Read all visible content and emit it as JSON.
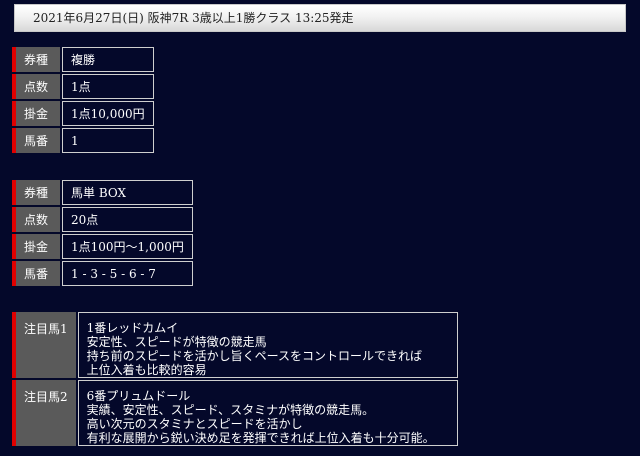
{
  "header": {
    "title": "2021年6月27日(日) 阪神7R 3歳以上1勝クラス 13:25発走"
  },
  "bet1": {
    "rows": [
      {
        "label": "券種",
        "value": "複勝"
      },
      {
        "label": "点数",
        "value": "1点"
      },
      {
        "label": "掛金",
        "value": "1点10,000円"
      },
      {
        "label": "馬番",
        "value": "1"
      }
    ]
  },
  "bet2": {
    "rows": [
      {
        "label": "券種",
        "value": "馬単 BOX"
      },
      {
        "label": "点数",
        "value": "20点"
      },
      {
        "label": "掛金",
        "value": "1点100円～1,000円"
      },
      {
        "label": "馬番",
        "value": "1 - 3 - 5 - 6 - 7"
      }
    ]
  },
  "notable": [
    {
      "label": "注目馬1",
      "lines": [
        "1番レッドカムイ",
        "安定性、スピードが特徴の競走馬",
        "持ち前のスピードを活かし旨くペースをコントロールできれば",
        "上位入着も比較的容易"
      ]
    },
    {
      "label": "注目馬2",
      "lines": [
        "6番プリュムドール",
        "実績、安定性、スピード、スタミナが特徴の競走馬。",
        "高い次元のスタミナとスピードを活かし",
        "有利な展開から鋭い決め足を発揮できれば上位入着も十分可能。"
      ]
    }
  ]
}
